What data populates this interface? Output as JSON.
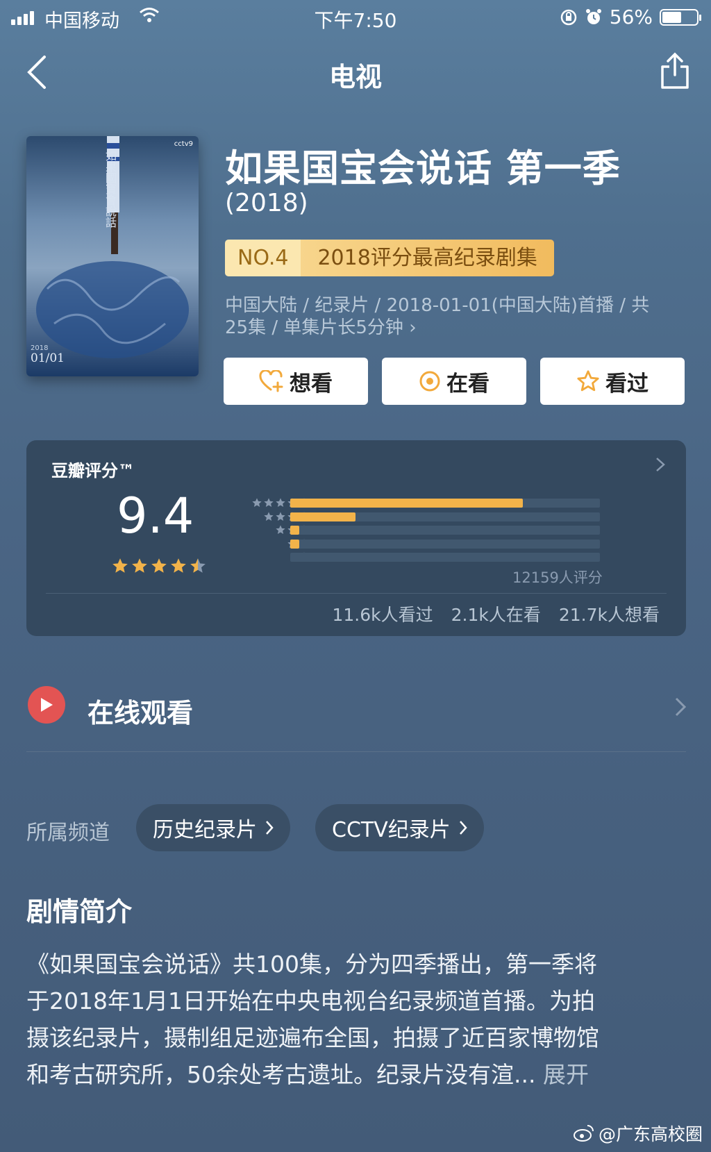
{
  "status_bar": {
    "carrier": "中国移动",
    "time": "下午7:50",
    "battery": "56%",
    "battery_level": 0.56
  },
  "nav": {
    "title": "电视"
  },
  "poster": {
    "side_text": "如果國寶會說話",
    "date_top": "2018",
    "date": "01/01",
    "logo": "cctv9"
  },
  "show": {
    "title": "如果国宝会说话 第一季",
    "year": "(2018)",
    "rank_no": "NO.4",
    "rank_text": "2018评分最高纪录剧集",
    "meta_line1": "中国大陆 / 纪录片 / 2018-01-01(中国大陆)首播 / 共",
    "meta_line2": "25集 / 单集片长5分钟",
    "meta_more": "›"
  },
  "actions": [
    {
      "label": "想看",
      "icon": "heart-plus-icon",
      "color": "#f2a93b"
    },
    {
      "label": "在看",
      "icon": "target-icon",
      "color": "#f2a93b"
    },
    {
      "label": "看过",
      "icon": "star-outline-icon",
      "color": "#f2a93b"
    }
  ],
  "rating": {
    "label": "豆瓣评分™",
    "score": "9.4",
    "stars": 4.5,
    "distribution": [
      0.75,
      0.21,
      0.03,
      0.03,
      0.0
    ],
    "count": "12159人评分",
    "watched": "11.6k人看过",
    "watching": "2.1k人在看",
    "want": "21.7k人想看"
  },
  "watch_online": {
    "label": "在线观看"
  },
  "channels": {
    "label": "所属频道",
    "items": [
      "历史纪录片",
      "CCTV纪录片"
    ]
  },
  "synopsis": {
    "title": "剧情简介",
    "lines": [
      "《如果国宝会说话》共100集，分为四季播出，第一季将",
      "于2018年1月1日开始在中央电视台纪录频道首播。为拍",
      "摄该纪录片，摄制组足迹遍布全国，拍摄了近百家博物馆",
      "和考古研究所，50余处考古遗址。纪录片没有渲..."
    ],
    "more": "展开"
  },
  "watermark": "@广东高校圈",
  "colors": {
    "accent": "#f2b34a",
    "play": "#e35453",
    "card": "#34495f"
  }
}
